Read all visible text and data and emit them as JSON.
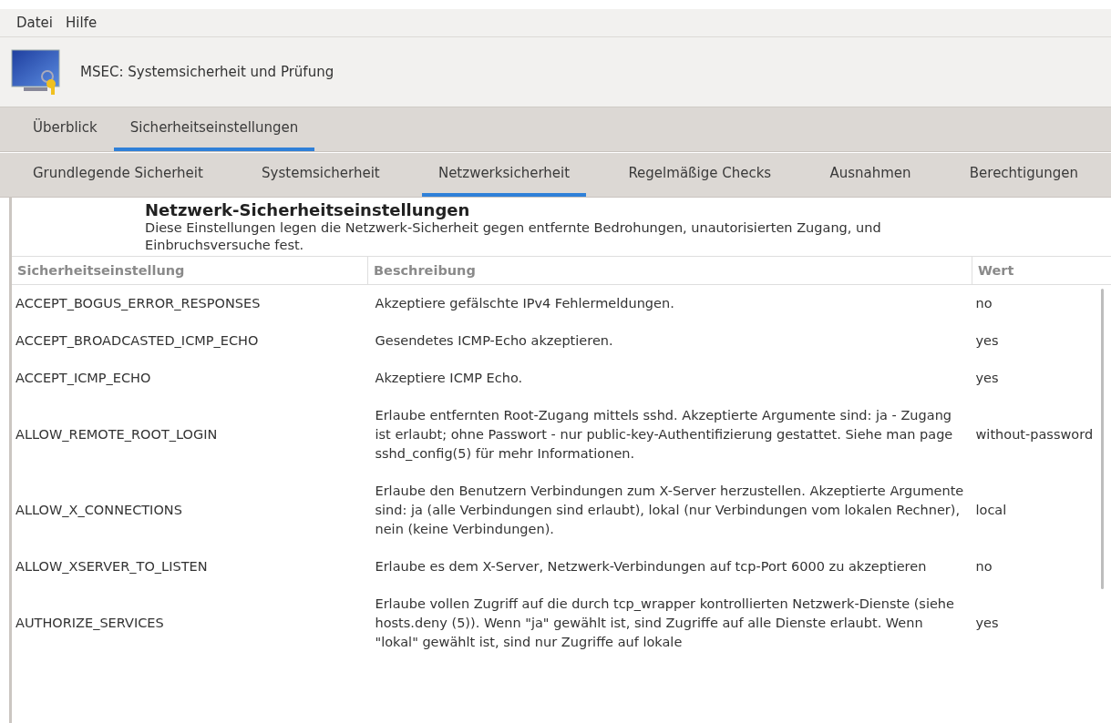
{
  "menu": [
    {
      "label": "Datei"
    },
    {
      "label": "Hilfe"
    }
  ],
  "header": {
    "title": "MSEC: Systemsicherheit und Prüfung"
  },
  "tabs": [
    {
      "label": "Überblick",
      "selected": false
    },
    {
      "label": "Sicherheitseinstellungen",
      "selected": true
    }
  ],
  "subtabs": [
    {
      "label": "Grundlegende Sicherheit",
      "selected": false
    },
    {
      "label": "Systemsicherheit",
      "selected": false
    },
    {
      "label": "Netzwerksicherheit",
      "selected": true
    },
    {
      "label": "Regelmäßige Checks",
      "selected": false
    },
    {
      "label": "Ausnahmen",
      "selected": false
    },
    {
      "label": "Berechtigungen",
      "selected": false
    }
  ],
  "section": {
    "title": "Netzwerk-Sicherheitseinstellungen",
    "description": "Diese Einstellungen legen die Netzwerk-Sicherheit gegen entfernte Bedrohungen, unautorisierten Zugang, und Einbruchsversuche fest."
  },
  "table": {
    "columns": [
      "Sicherheitseinstellung",
      "Beschreibung",
      "Wert"
    ],
    "rows": [
      {
        "setting": "ACCEPT_BOGUS_ERROR_RESPONSES",
        "description": "Akzeptiere gefälschte IPv4 Fehlermeldungen.",
        "value": "no"
      },
      {
        "setting": "ACCEPT_BROADCASTED_ICMP_ECHO",
        "description": "Gesendetes ICMP-Echo akzeptieren.",
        "value": "yes"
      },
      {
        "setting": "ACCEPT_ICMP_ECHO",
        "description": "Akzeptiere ICMP Echo.",
        "value": "yes"
      },
      {
        "setting": "ALLOW_REMOTE_ROOT_LOGIN",
        "description": "Erlaube entfernten Root-Zugang mittels sshd. Akzeptierte Argumente sind: ja - Zugang ist erlaubt; ohne Passwort - nur public-key-Authentifizierung gestattet. Siehe man page sshd_config(5) für mehr Informationen.",
        "value": "without-password"
      },
      {
        "setting": "ALLOW_X_CONNECTIONS",
        "description": "Erlaube den Benutzern Verbindungen zum X-Server herzustellen. Akzeptierte Argumente sind: ja (alle Verbindungen sind erlaubt), lokal (nur Verbindungen vom lokalen Rechner), nein (keine Verbindungen).",
        "value": "local"
      },
      {
        "setting": "ALLOW_XSERVER_TO_LISTEN",
        "description": "Erlaube es dem X-Server, Netzwerk-Verbindungen auf tcp-Port 6000 zu akzeptieren",
        "value": "no"
      },
      {
        "setting": "AUTHORIZE_SERVICES",
        "description": "Erlaube vollen Zugriff auf die durch tcp_wrapper kontrollierten Netzwerk-Dienste (siehe hosts.deny (5)). Wenn \"ja\" gewählt ist, sind Zugriffe auf alle Dienste erlaubt. Wenn \"lokal\" gewählt ist, sind nur Zugriffe auf lokale",
        "value": "yes"
      }
    ]
  }
}
